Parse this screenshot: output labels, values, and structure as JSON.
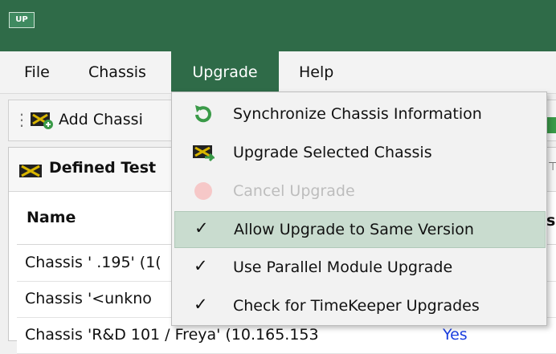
{
  "app": {
    "icon_text": "UP"
  },
  "menubar": {
    "file": "File",
    "chassis": "Chassis",
    "upgrade": "Upgrade",
    "help": "Help"
  },
  "toolbar": {
    "add_chassis_label": "Add Chassi"
  },
  "panel": {
    "title": "Defined Test",
    "column_name": "Name",
    "column_partial": "s?",
    "rows": [
      {
        "name": "Chassis ' .195' (1("
      },
      {
        "name": "Chassis '<unkno"
      },
      {
        "name": "Chassis 'R&D 101 / Freya' (10.165.153",
        "value": "Yes"
      }
    ]
  },
  "upgrade_menu": {
    "items": [
      {
        "label": "Synchronize Chassis Information",
        "icon": "sync-icon"
      },
      {
        "label": "Upgrade Selected Chassis",
        "icon": "upgrade-chassis-icon"
      },
      {
        "label": "Cancel Upgrade",
        "icon": "cancel-icon",
        "disabled": true
      },
      {
        "label": "Allow Upgrade to Same Version",
        "checked": true,
        "highlighted": true
      },
      {
        "label": "Use Parallel Module Upgrade",
        "checked": true
      },
      {
        "label": "Check for TimeKeeper Upgrades",
        "checked": true
      }
    ],
    "check_glyph": "✓"
  },
  "colors": {
    "titlebar": "#2f6b48",
    "highlight": "#c9dccf",
    "link": "#1a3ee0"
  }
}
